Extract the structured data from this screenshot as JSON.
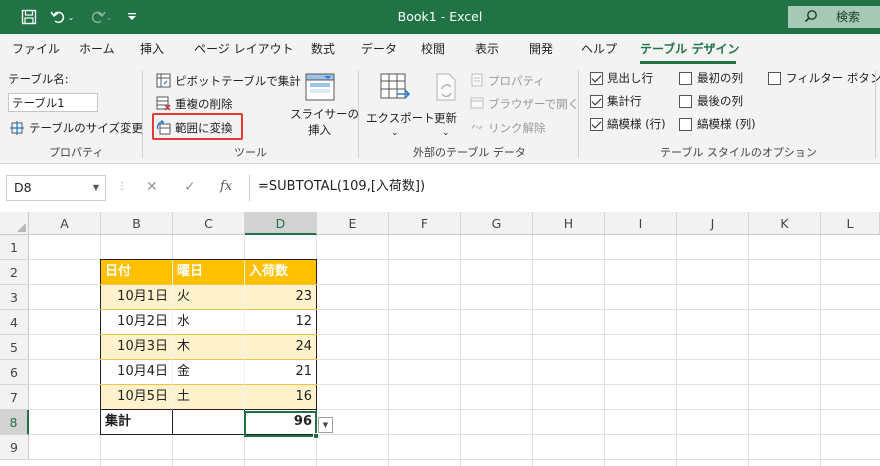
{
  "window": {
    "title": "Book1  -  Excel",
    "search_label": "検索"
  },
  "menu_tabs": [
    "ファイル",
    "ホーム",
    "挿入",
    "ページ レイアウト",
    "数式",
    "データ",
    "校閲",
    "表示",
    "開発",
    "ヘルプ",
    "テーブル デザイン"
  ],
  "active_tab": "テーブル デザイン",
  "ribbon": {
    "properties": {
      "name_label": "テーブル名:",
      "name_value": "テーブル1",
      "resize_label": "テーブルのサイズ変更",
      "group_label": "プロパティ"
    },
    "tools": {
      "pivot_label": "ピボットテーブルで集計",
      "remove_dup_label": "重複の削除",
      "convert_label": "範囲に変換",
      "slicer_label_1": "スライサーの",
      "slicer_label_2": "挿入",
      "group_label": "ツール"
    },
    "external": {
      "export_label": "エクスポート",
      "refresh_label": "更新",
      "properties_label": "プロパティ",
      "browser_label": "ブラウザーで開く",
      "unlink_label": "リンク解除",
      "group_label": "外部のテーブル データ"
    },
    "style_options": {
      "header_row": {
        "label": "見出し行",
        "checked": true
      },
      "total_row": {
        "label": "集計行",
        "checked": true
      },
      "banded_rows": {
        "label": "縞模様 (行)",
        "checked": true
      },
      "first_column": {
        "label": "最初の列",
        "checked": false
      },
      "last_column": {
        "label": "最後の列",
        "checked": false
      },
      "banded_columns": {
        "label": "縞模様 (列)",
        "checked": false
      },
      "filter_button": {
        "label": "フィルター ボタン",
        "checked": false
      },
      "group_label": "テーブル スタイルのオプション"
    }
  },
  "formula_bar": {
    "cell_ref": "D8",
    "formula": "=SUBTOTAL(109,[入荷数])",
    "fx_label": "fx"
  },
  "sheet": {
    "columns": [
      "A",
      "B",
      "C",
      "D",
      "E",
      "F",
      "G",
      "H",
      "I",
      "J",
      "K",
      "L"
    ],
    "rows": [
      "1",
      "2",
      "3",
      "4",
      "5",
      "6",
      "7",
      "8",
      "9"
    ],
    "selected_cell": "D8",
    "table": {
      "headers": [
        "日付",
        "曜日",
        "入荷数"
      ],
      "rows": [
        [
          "10月1日",
          "火",
          "23"
        ],
        [
          "10月2日",
          "水",
          "12"
        ],
        [
          "10月3日",
          "木",
          "24"
        ],
        [
          "10月4日",
          "金",
          "21"
        ],
        [
          "10月5日",
          "土",
          "16"
        ]
      ],
      "total": {
        "label": "集計",
        "value": "96"
      }
    }
  },
  "colors": {
    "excel_green": "#217346",
    "table_header": "#ffc000",
    "table_band": "#fff2cc",
    "highlight": "#e53935"
  }
}
